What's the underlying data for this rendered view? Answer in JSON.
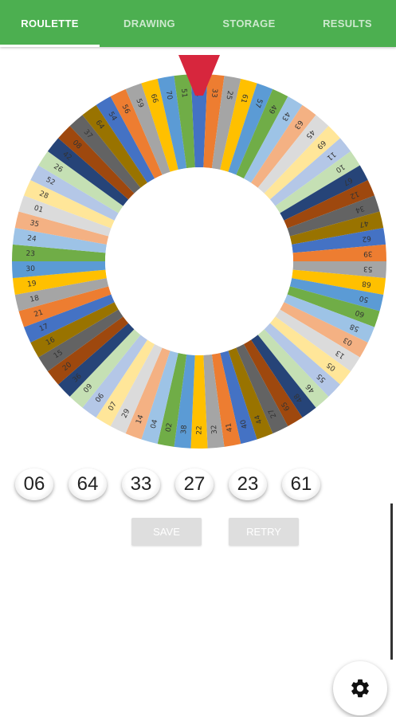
{
  "tabs": [
    {
      "label": "ROULETTE",
      "active": true
    },
    {
      "label": "DRAWING",
      "active": false
    },
    {
      "label": "STORAGE",
      "active": false
    },
    {
      "label": "RESULTS",
      "active": false
    }
  ],
  "wheel": {
    "segment_numbers_clockwise_from_top": [
      "31",
      "33",
      "25",
      "61",
      "57",
      "49",
      "43",
      "63",
      "45",
      "69",
      "11",
      "10",
      "67",
      "12",
      "34",
      "47",
      "62",
      "39",
      "53",
      "68",
      "50",
      "60",
      "58",
      "03",
      "13",
      "05",
      "55",
      "46",
      "48",
      "65",
      "27",
      "44",
      "40",
      "41",
      "32",
      "22",
      "38",
      "02",
      "04",
      "14",
      "29",
      "07",
      "06",
      "09",
      "36",
      "20",
      "15",
      "16",
      "17",
      "21",
      "18",
      "19",
      "30",
      "23",
      "24",
      "35",
      "01",
      "28",
      "52",
      "26",
      "42",
      "08",
      "37",
      "64",
      "54",
      "56",
      "59",
      "66",
      "70",
      "51"
    ],
    "pointer_color": "#d7263d"
  },
  "drawn_numbers": [
    "06",
    "64",
    "33",
    "27",
    "23",
    "61"
  ],
  "buttons": {
    "save_label": "SAVE",
    "retry_label": "RETRY"
  },
  "fab": {
    "icon": "gear-icon"
  },
  "colors": {
    "primary": "#4caf50",
    "accent": "#d7263d",
    "button_disabled": "#dedede"
  }
}
